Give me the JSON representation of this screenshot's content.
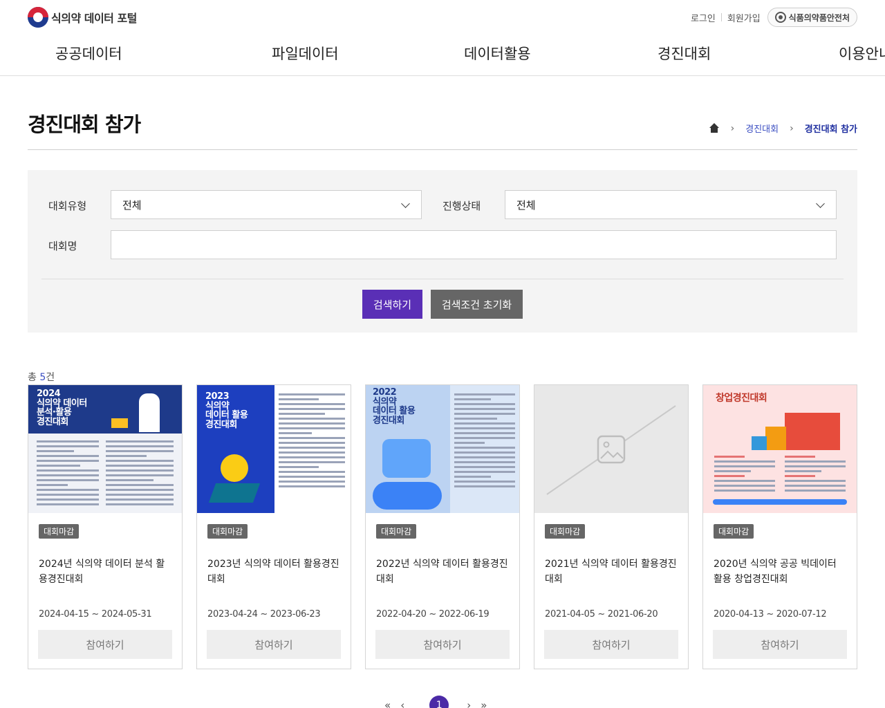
{
  "header": {
    "logo_text": "식의약 데이터 포털",
    "login": "로그인",
    "signup": "회원가입",
    "agency": "식품의약품안전처"
  },
  "gnb": [
    "공공데이터",
    "파일데이터",
    "데이터활용",
    "경진대회",
    "이용안내"
  ],
  "page": {
    "title": "경진대회 참가",
    "breadcrumb": [
      "경진대회",
      "경진대회 참가"
    ]
  },
  "search": {
    "type_label": "대회유형",
    "type_value": "전체",
    "status_label": "진행상태",
    "status_value": "전체",
    "name_label": "대회명",
    "name_value": "",
    "search_button": "검색하기",
    "reset_button": "검색조건 초기화"
  },
  "result": {
    "count_prefix": "총 ",
    "count": "5",
    "count_suffix": "건"
  },
  "cards": [
    {
      "badge": "대회마감",
      "title": "2024년 식의약 데이터 분석 활용경진대회",
      "date": "2024-04-15 ~ 2024-05-31",
      "button": "참여하기",
      "poster_text": "2024\n식의약 데이터\n분석·활용\n경진대회"
    },
    {
      "badge": "대회마감",
      "title": "2023년 식의약 데이터 활용경진대회",
      "date": "2023-04-24 ~ 2023-06-23",
      "button": "참여하기",
      "poster_text": "2023\n식의약\n데이터 활용\n경진대회"
    },
    {
      "badge": "대회마감",
      "title": "2022년 식의약 데이터 활용경진대회",
      "date": "2022-04-20 ~ 2022-06-19",
      "button": "참여하기",
      "poster_text": "2022\n식의약\n데이터 활용\n경진대회"
    },
    {
      "badge": "대회마감",
      "title": "2021년 식의약 데이터 활용경진대회",
      "date": "2021-04-05 ~ 2021-06-20",
      "button": "참여하기",
      "poster_text": ""
    },
    {
      "badge": "대회마감",
      "title": "2020년 식의약 공공 빅데이터 활용 창업경진대회",
      "date": "2020-04-13 ~ 2020-07-12",
      "button": "참여하기",
      "poster_text": "창업경진대회"
    }
  ],
  "pagination": {
    "first": "«",
    "prev": "‹",
    "current": "1",
    "next": "›",
    "last": "»"
  },
  "colors": {
    "primary": "#5a2fb6",
    "link": "#3b4ec2",
    "badge": "#666666"
  }
}
